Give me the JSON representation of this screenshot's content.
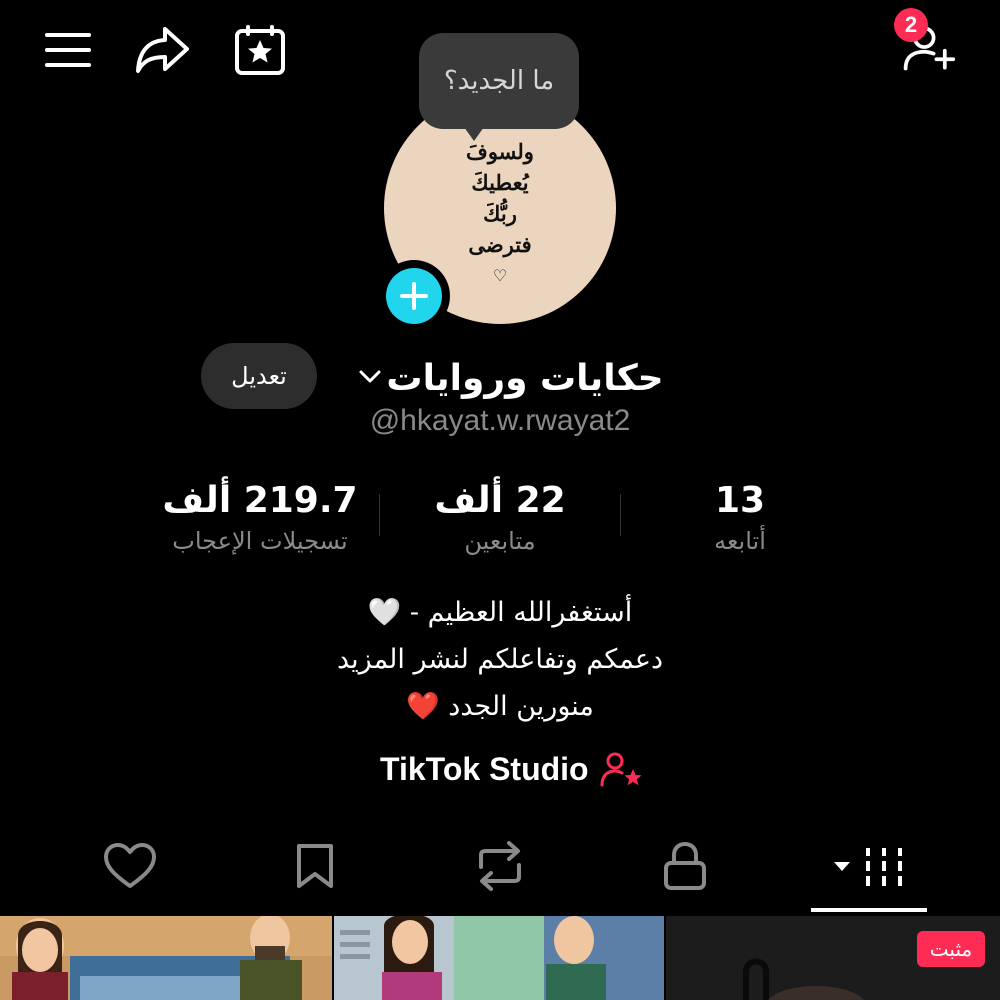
{
  "header": {
    "menu_icon": "hamburger-icon",
    "share_icon": "share-arrow-icon",
    "calendar_icon": "calendar-star-icon",
    "add_friend_icon": "add-user-icon",
    "notification_count": "2"
  },
  "profile": {
    "tooltip": "ما الجديد؟",
    "avatar_lines": [
      "ولسوفَ",
      "يُعطيكَ",
      "ربُّكَ",
      "فترضى",
      "♡"
    ],
    "name": "حكايات وروايات",
    "handle": "@hkayat.w.rwayat2",
    "edit_label": "تعديل",
    "colors": {
      "plus": "#20d5ec",
      "accent": "#fe2c55"
    }
  },
  "stats": [
    {
      "value": "13",
      "label": "أتابعه"
    },
    {
      "value": "22 ألف",
      "label": "متابعين"
    },
    {
      "value": "219.7 ألف",
      "label": "تسجيلات الإعجاب"
    }
  ],
  "bio": {
    "line1": "أستغفرالله العظيم - 🤍",
    "line2": "دعمكم وتفاعلكم لنشر المزيد",
    "line3": "منورين الجدد ❤️"
  },
  "studio": {
    "label": "TikTok Studio",
    "icon": "creator-star-icon"
  },
  "tabs": [
    {
      "name": "videos",
      "icon": "grid-icon",
      "active": true
    },
    {
      "name": "private",
      "icon": "lock-icon"
    },
    {
      "name": "reposts",
      "icon": "repost-icon"
    },
    {
      "name": "favorites",
      "icon": "bookmark-icon"
    },
    {
      "name": "liked",
      "icon": "heart-icon"
    }
  ],
  "videos": {
    "pinned_label": "مثبت"
  }
}
